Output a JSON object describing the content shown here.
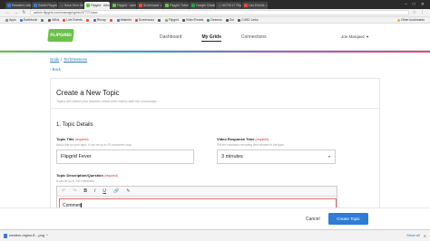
{
  "browser": {
    "tabs": [
      {
        "label": "Resident Letter",
        "color": "#3a7bd5",
        "active": false
      },
      {
        "label": "Sweet Flipgrid",
        "color": "#3a7bd5",
        "active": false
      },
      {
        "label": "Save Tech Sess",
        "color": "#555555",
        "active": false
      },
      {
        "label": "Flipgrid · Admin",
        "color": "#6cc04a",
        "active": true
      },
      {
        "label": "Flipgrid · Admin",
        "color": "#6cc04a",
        "active": false
      },
      {
        "label": "Screencast",
        "color": "#e84c3d",
        "active": false
      },
      {
        "label": "Flipgrid Tutori",
        "color": "#6cc04a",
        "active": false
      },
      {
        "label": "Google Classr",
        "color": "#2e9b4e",
        "active": false
      },
      {
        "label": "NCTM 17 Flipgr",
        "color": "#555555",
        "active": false
      },
      {
        "label": "Live Events",
        "color": "#e84c3d",
        "active": false
      }
    ],
    "url": "admin.flipgrid.com/manage/grids/47771/new",
    "bookmarks": [
      {
        "label": "Apps",
        "color": "#888888"
      },
      {
        "label": "Earthbook",
        "color": "#3a7bd5"
      },
      {
        "label": "",
        "color": "#2e9b4e"
      },
      {
        "label": "Wikis",
        "color": "#555555"
      },
      {
        "label": "Live Events",
        "color": "#e84c3d"
      },
      {
        "label": "",
        "color": "#e84c3d"
      },
      {
        "label": "Recap",
        "color": "#6a5acd"
      },
      {
        "label": "",
        "color": "#e84c3d"
      },
      {
        "label": "Wakelet",
        "color": "#3a7bd5"
      },
      {
        "label": "Screencast",
        "color": "#e84c3d"
      },
      {
        "label": "",
        "color": "#555555"
      },
      {
        "label": "Flipgrid",
        "color": "#6cc04a"
      },
      {
        "label": "VideoThread",
        "color": "#555555"
      },
      {
        "label": "Desmos",
        "color": "#2e9b4e"
      },
      {
        "label": "Out",
        "color": "#555555"
      },
      {
        "label": "CUSD Links",
        "color": "#555555"
      }
    ],
    "other_bookmarks": "Other bookmarks"
  },
  "app": {
    "logo": "FLIPGRID",
    "nav": [
      {
        "label": "Dashboard",
        "active": false
      },
      {
        "label": "My Grids",
        "active": true
      },
      {
        "label": "Connections",
        "active": false
      }
    ],
    "user": "Joe Marquez"
  },
  "breadcrumb": {
    "root": "Grids",
    "sep": "/",
    "current": "TechSessions"
  },
  "back": "‹ Back",
  "form": {
    "title": "Create a New Topic",
    "subtitle": "Topics are where your learners share their videos with the community.",
    "section": "1. Topic Details",
    "topic_title_label": "Topic Title",
    "topic_title_req": "(required)",
    "topic_title_help": "Add a title for your topic. It can be up to 35 characters long.",
    "topic_title_value": "Flipgrid Fever",
    "response_time_label": "Video Response Time",
    "response_time_req": "(required)",
    "response_time_help": "Set the maximum recording time allowed in the topic.",
    "response_time_value": "3 minutes",
    "description_label": "Topic Description/Question",
    "description_req": "(required)",
    "description_help": "It can be up to 350 characters.",
    "description_value": "Commen",
    "toolbar": {
      "undo": "↶",
      "redo": "↷",
      "bold": "B",
      "italic": "I",
      "underline": "U",
      "link": "🔗",
      "clear": "✎"
    }
  },
  "footer": {
    "cancel": "Cancel",
    "create": "Create Topic"
  },
  "downloads": {
    "file": "western-region-fl....png",
    "show_all": "Show all"
  }
}
